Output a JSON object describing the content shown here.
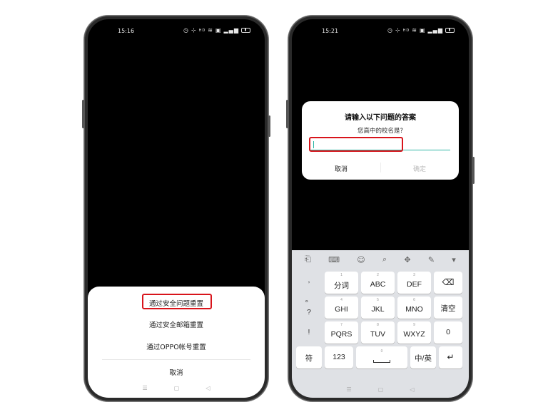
{
  "left_phone": {
    "status_time": "15:16",
    "status_icons": [
      "alarm-icon",
      "nfc-icon",
      "hd-icon",
      "wifi-icon",
      "sim-icon",
      "signal-icon",
      "battery-icon"
    ],
    "sheet": {
      "option_security_question": "通过安全问题重置",
      "option_security_email": "通过安全邮箱重置",
      "option_oppo_account": "通过OPPO帐号重置",
      "cancel": "取消"
    },
    "nav": {
      "menu": "☰",
      "home": "▢",
      "back": "◁"
    }
  },
  "right_phone": {
    "status_time": "15:21",
    "dialog": {
      "title": "请输入以下问题的答案",
      "question": "您高中的校名是?",
      "answer_value": "",
      "cancel": "取消",
      "confirm": "确定"
    },
    "keyboard": {
      "toolbar": [
        "clipboard-icon",
        "keyboard-icon",
        "emoji-icon",
        "search-icon",
        "cursor-move-icon",
        "handwriting-icon",
        "collapse-icon"
      ],
      "side_symbols": [
        ",",
        "。",
        "?",
        "!"
      ],
      "row1": [
        {
          "num": "1",
          "label": "分词"
        },
        {
          "num": "2",
          "label": "ABC"
        },
        {
          "num": "3",
          "label": "DEF"
        }
      ],
      "row2": [
        {
          "num": "4",
          "label": "GHI"
        },
        {
          "num": "5",
          "label": "JKL"
        },
        {
          "num": "6",
          "label": "MNO"
        }
      ],
      "row3": [
        {
          "num": "7",
          "label": "PQRS"
        },
        {
          "num": "8",
          "label": "TUV"
        },
        {
          "num": "9",
          "label": "WXYZ"
        }
      ],
      "backspace": "⌫",
      "clear": "清空",
      "zero": "0",
      "symbol_key": "符",
      "num_key": "123",
      "space_num": "0",
      "lang_key": "中/英",
      "enter": "↵"
    },
    "nav": {
      "menu": "☰",
      "home": "▢",
      "back": "◁"
    }
  },
  "colors": {
    "highlight_red": "#d8141b",
    "accent_teal": "#2fb6a5"
  }
}
